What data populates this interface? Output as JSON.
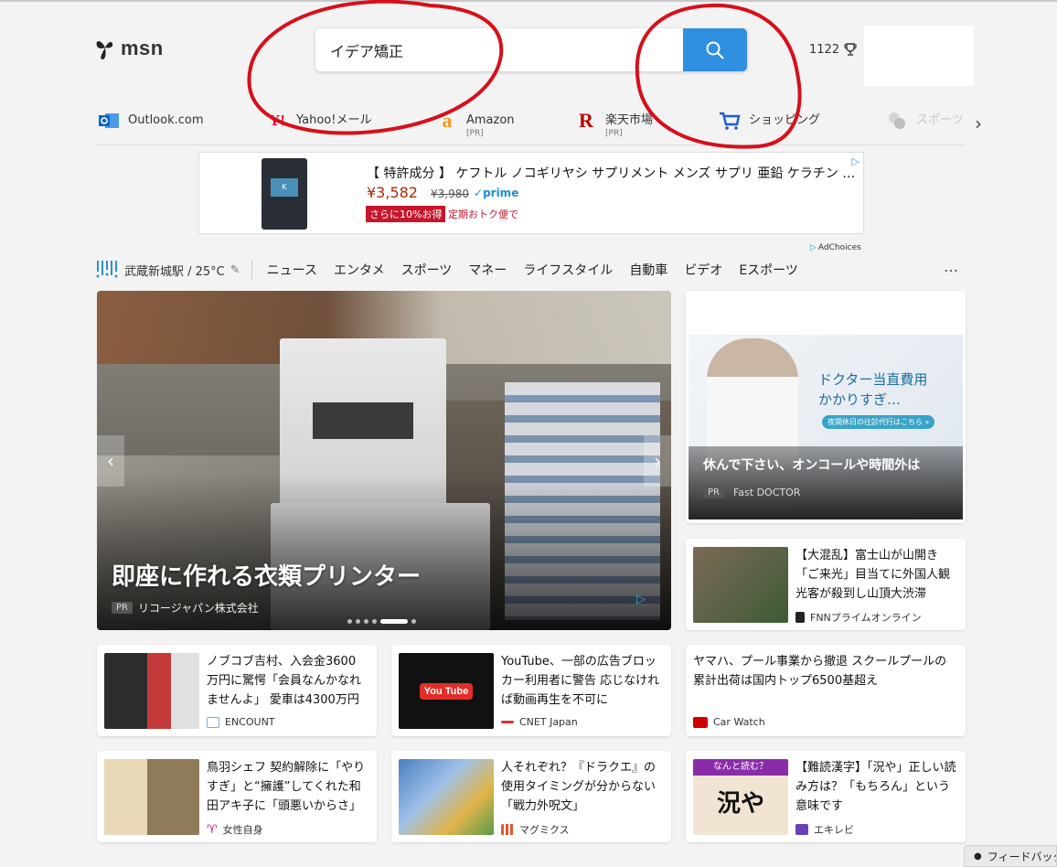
{
  "header": {
    "logo_text": "msn",
    "search_value": "イデア矯正",
    "points": "1122"
  },
  "quick_links": [
    {
      "label": "Outlook.com",
      "pr": "",
      "icon": "outlook-icon",
      "color": "#0a64c8"
    },
    {
      "label": "Yahoo!メール",
      "pr": "",
      "icon": "yahoo-icon",
      "color": "#ff0033"
    },
    {
      "label": "Amazon",
      "pr": "[PR]",
      "icon": "amazon-icon",
      "color": "#f39b1c"
    },
    {
      "label": "楽天市場",
      "pr": "[PR]",
      "icon": "rakuten-icon",
      "color": "#bf0000"
    },
    {
      "label": "ショッピング",
      "pr": "",
      "icon": "cart-icon",
      "color": "#1f5cc9"
    },
    {
      "label": "スポーツ",
      "pr": "",
      "icon": "sports-icon",
      "color": "#c9c9c9"
    }
  ],
  "ad": {
    "title": "【 特許成分 】 ケフトル ノコギリヤシ サプリメント メンズ サプリ 亜鉛 ケラチン ビタミン",
    "price": "¥3,582",
    "old_price": "¥3,980",
    "prime": "prime",
    "badge": "さらに10%お得",
    "teiki": "定期おトク便で",
    "adchoices": "AdChoices"
  },
  "nav": {
    "weather": "武蔵新城駅 / 25°C",
    "items": [
      "ニュース",
      "エンタメ",
      "スポーツ",
      "マネー",
      "ライフスタイル",
      "自動車",
      "ビデオ",
      "Eスポーツ"
    ],
    "more": "…"
  },
  "hero": {
    "headline": "即座に作れる衣類プリンター",
    "pr": "PR",
    "source": "リコージャパン株式会社",
    "slides": 6,
    "active_slide": 5
  },
  "side_ad": {
    "copy_line1": "ドクター当直費用",
    "copy_line2": "かかりすぎ…",
    "copy_small": "夜間休日の往診代行はこちら »",
    "title": "休んで下さい、オンコールや時間外は",
    "pr": "PR",
    "source": "Fast DOCTOR"
  },
  "cards": [
    {
      "title": "【大混乱】富士山が山開き「ご来光」目当てに外国人観光客が殺到し山頂大渋滞",
      "source": "FNNプライムオンライン",
      "logo_color": "#222",
      "thumb": [
        "#7b6a57",
        "#3e5b35"
      ]
    },
    {
      "title": "ノブコブ吉村、入会金3600万円に驚愕「会員なんかなれませんよ」 愛車は4300万円",
      "source": "ENCOUNT",
      "logo_color": "#6ab0e2",
      "thumb": [
        "#c43a3a",
        "#d9d9d9"
      ]
    },
    {
      "title": "YouTube、一部の広告ブロッカー利用者に警告 応じなければ動画再生を不可に",
      "source": "CNET Japan",
      "logo_color": "#d33",
      "thumb": [
        "#111",
        "#333"
      ]
    },
    {
      "title": "ヤマハ、プール事業から撤退 スクールプールの累計出荷は国内トップ6500基超え",
      "source": "Car Watch",
      "logo_color": "#c00",
      "thumb": []
    },
    {
      "title": "鳥羽シェフ 契約解除に「やりすぎ」と“擁護”してくれた和田アキ子に「頭悪いからさ」",
      "source": "女性自身",
      "logo_color": "#c41e7a",
      "thumb": [
        "#c9b48a",
        "#8f7a5a"
      ]
    },
    {
      "title": "人それぞれ？『ドラクエ』の使用タイミングが分からない「戦力外呪文」",
      "source": "マグミクス",
      "logo_color": "#e4572e",
      "thumb": [
        "#4a7fc1",
        "#e0b54a"
      ]
    },
    {
      "title": "【難読漢字】「況や」正しい読み方は？「もちろん」という意味です",
      "source": "エキレビ",
      "logo_color": "#6a3fb5",
      "thumb": [
        "#f2e4d2",
        "#8a2ca8"
      ],
      "quiz_label": "なんと読む？",
      "quiz_word": "況や"
    }
  ],
  "feedback": "フィードバック"
}
